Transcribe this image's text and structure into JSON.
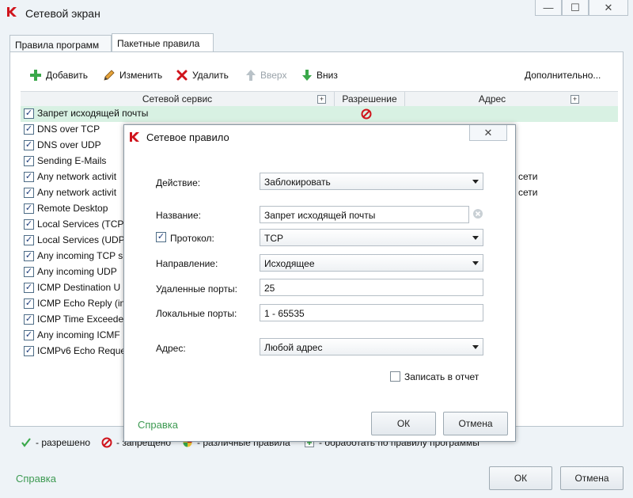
{
  "window": {
    "title": "Сетевой экран"
  },
  "tabs": [
    {
      "label": "Правила программ"
    },
    {
      "label": "Пакетные правила"
    }
  ],
  "toolbar": {
    "add": "Добавить",
    "edit": "Изменить",
    "delete": "Удалить",
    "up": "Вверх",
    "down": "Вниз",
    "more": "Дополнительно..."
  },
  "grid": {
    "columns": {
      "service": "Сетевой сервис",
      "permission": "Разрешение",
      "address": "Адрес"
    },
    "rows": [
      {
        "label": "Запрет исходящей почты"
      },
      {
        "label": "DNS over TCP"
      },
      {
        "label": "DNS over UDP"
      },
      {
        "label": "Sending E-Mails"
      },
      {
        "label": "Any network activit",
        "address": "сети"
      },
      {
        "label": "Any network activit",
        "address": "сети"
      },
      {
        "label": "Remote Desktop"
      },
      {
        "label": "Local Services (TCP)"
      },
      {
        "label": "Local Services (UDP"
      },
      {
        "label": "Any incoming TCP s"
      },
      {
        "label": "Any incoming UDP"
      },
      {
        "label": "ICMP Destination U"
      },
      {
        "label": "ICMP Echo Reply (in"
      },
      {
        "label": "ICMP Time Exceede"
      },
      {
        "label": "Any incoming ICMF"
      },
      {
        "label": "ICMPv6 Echo Reque"
      }
    ]
  },
  "legend": {
    "allowed": "- разрешено",
    "forbidden": "- запрещено",
    "mixed": "- различные правила",
    "by_program": "- обработать по правилу программы"
  },
  "footer": {
    "help": "Справка",
    "ok": "ОК",
    "cancel": "Отмена"
  },
  "dialog": {
    "title": "Сетевое правило",
    "action_label": "Действие:",
    "action_value": "Заблокировать",
    "name_label": "Название:",
    "name_value": "Запрет исходящей почты",
    "protocol_label": "Протокол:",
    "protocol_value": "TCP",
    "direction_label": "Направление:",
    "direction_value": "Исходящее",
    "remote_ports_label": "Удаленные порты:",
    "remote_ports_value": "25",
    "local_ports_label": "Локальные порты:",
    "local_ports_value": "1 - 65535",
    "address_label": "Адрес:",
    "address_value": "Любой адрес",
    "log_label": "Записать в отчет",
    "help": "Справка",
    "ok": "ОК",
    "cancel": "Отмена"
  },
  "colors": {
    "accent_green": "#3d9a52",
    "selected_row": "#d8f1e3",
    "forbidden_red": "#d0141c"
  }
}
